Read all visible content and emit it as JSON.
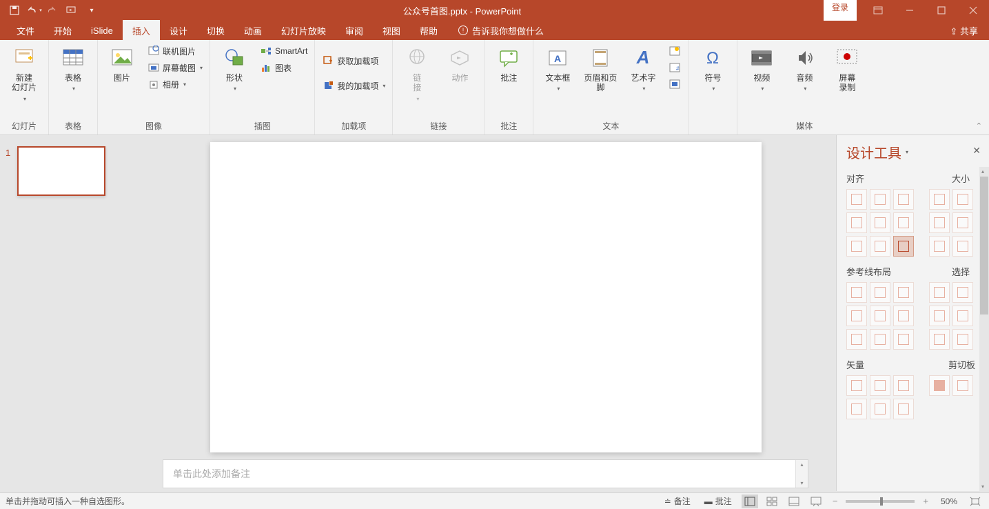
{
  "title": "公众号首图.pptx",
  "app_name": "PowerPoint",
  "login": "登录",
  "share": "共享",
  "tabs": {
    "file": "文件",
    "home": "开始",
    "islide": "iSlide",
    "insert": "插入",
    "design": "设计",
    "transition": "切换",
    "animation": "动画",
    "slideshow": "幻灯片放映",
    "review": "审阅",
    "view": "视图",
    "help": "帮助"
  },
  "tellme": "告诉我你想做什么",
  "ribbon": {
    "slides": {
      "new_slide": "新建\n幻灯片",
      "label": "幻灯片"
    },
    "tables": {
      "table": "表格",
      "label": "表格"
    },
    "images": {
      "picture": "图片",
      "online_pic": "联机图片",
      "screenshot": "屏幕截图",
      "album": "相册",
      "label": "图像"
    },
    "illustrations": {
      "shapes": "形状",
      "smartart": "SmartArt",
      "chart": "图表",
      "label": "插图"
    },
    "addins": {
      "get": "获取加载项",
      "my": "我的加载项",
      "label": "加载项"
    },
    "links": {
      "link": "链\n接",
      "action": "动作",
      "label": "链接"
    },
    "comments": {
      "comment": "批注",
      "label": "批注"
    },
    "text": {
      "textbox": "文本框",
      "headerfooter": "页眉和页脚",
      "wordart": "艺术字",
      "label": "文本"
    },
    "symbols": {
      "symbol": "符号"
    },
    "media": {
      "video": "视频",
      "audio": "音频",
      "screen_rec": "屏幕\n录制",
      "label": "媒体"
    }
  },
  "slide_num": "1",
  "notes_placeholder": "单击此处添加备注",
  "pane": {
    "title": "设计工具",
    "align": "对齐",
    "size": "大小",
    "guides": "参考线布局",
    "select": "选择",
    "vector": "矢量",
    "clipboard": "剪切板"
  },
  "status": {
    "left": "单击并拖动可插入一种自选图形。",
    "notes": "备注",
    "comments": "批注",
    "zoom": "50%"
  }
}
